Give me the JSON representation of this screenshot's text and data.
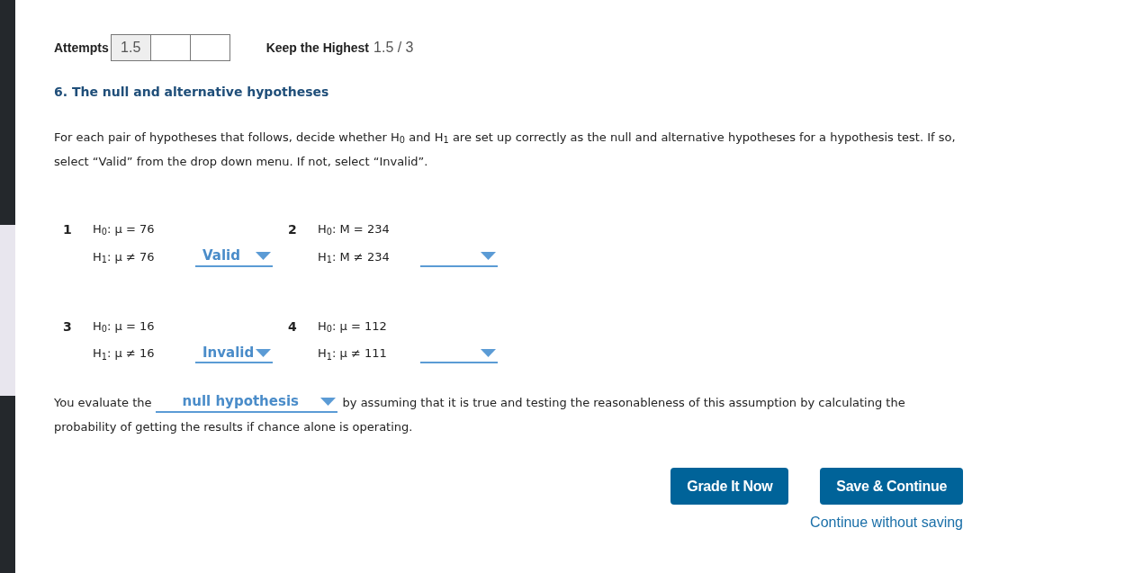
{
  "attempts": {
    "label": "Attempts",
    "slots": [
      {
        "value": "1.5",
        "filled": true
      },
      {
        "filled": false
      },
      {
        "filled": false
      }
    ],
    "policy": "Keep the Highest",
    "score": "1.5 / 3"
  },
  "question": {
    "title": "6. The null and alternative hypotheses",
    "instructions": "For each pair of hypotheses that follows, decide whether H$_{0}$ and H$_{1}$ are set up correctly as the null and alternative hypotheses for a hypothesis test. If so, select “Valid” from the drop down menu. If not, select “Invalid”.",
    "items": [
      {
        "number": "1",
        "h0": "H$_{0}$: μ = 76",
        "h1": "H$_{1}$: μ ≠ 76",
        "answer": "Valid"
      },
      {
        "number": "2",
        "h0": "H$_{0}$: M = 234",
        "h1": "H$_{1}$: M ≠ 234"
      },
      {
        "number": "3",
        "h0": "H$_{0}$: μ = 16",
        "h1": "H$_{1}$: μ ≠ 16",
        "answer": "Invalid"
      },
      {
        "number": "4",
        "h0": "H$_{0}$: μ = 112",
        "h1": "H$_{1}$: μ ≠ 111"
      }
    ],
    "sentence": {
      "before": "You evaluate the",
      "answer": "null hypothesis",
      "after": "by assuming that it is true and testing the reasonableness of this assumption by calculating the",
      "continuation": "probability of getting the results if chance alone is operating."
    }
  },
  "actions": {
    "buttons": [
      {
        "label": "Grade It Now"
      },
      {
        "label": "Save & Continue"
      }
    ],
    "link": "Continue without saving"
  }
}
